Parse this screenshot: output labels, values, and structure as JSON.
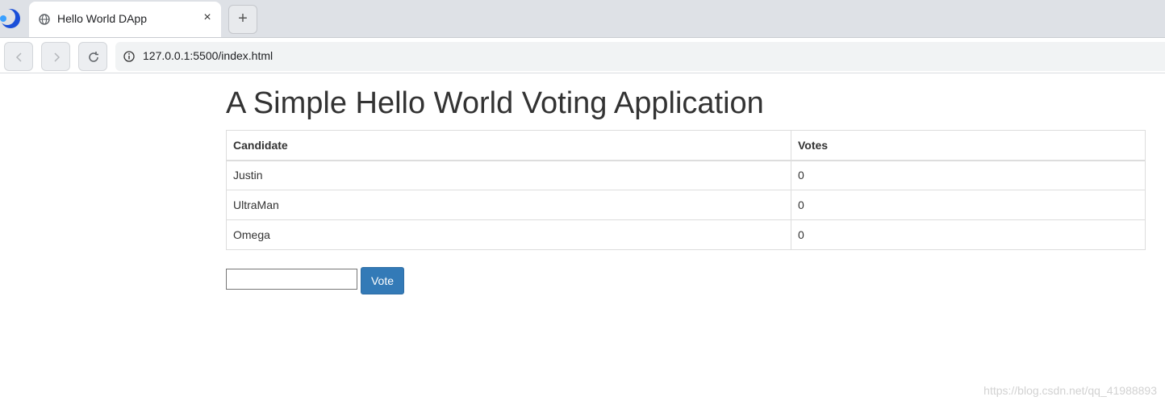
{
  "browser": {
    "tab": {
      "title": "Hello World DApp",
      "close_glyph": "×",
      "icon": "globe-icon"
    },
    "new_tab_glyph": "+",
    "toolbar": {
      "back_icon": "back-arrow-icon",
      "forward_icon": "forward-arrow-icon",
      "reload_icon": "reload-icon",
      "url": "127.0.0.1:5500/index.html"
    }
  },
  "page": {
    "title": "A Simple Hello World Voting Application",
    "table": {
      "headers": [
        "Candidate",
        "Votes"
      ],
      "rows": [
        {
          "candidate": "Justin",
          "votes": "0"
        },
        {
          "candidate": "UltraMan",
          "votes": "0"
        },
        {
          "candidate": "Omega",
          "votes": "0"
        }
      ]
    },
    "vote_input": {
      "value": "",
      "placeholder": ""
    },
    "vote_button": "Vote",
    "colors": {
      "button": "#337ab7",
      "text": "#333333"
    }
  },
  "watermark": "https://blog.csdn.net/qq_41988893"
}
